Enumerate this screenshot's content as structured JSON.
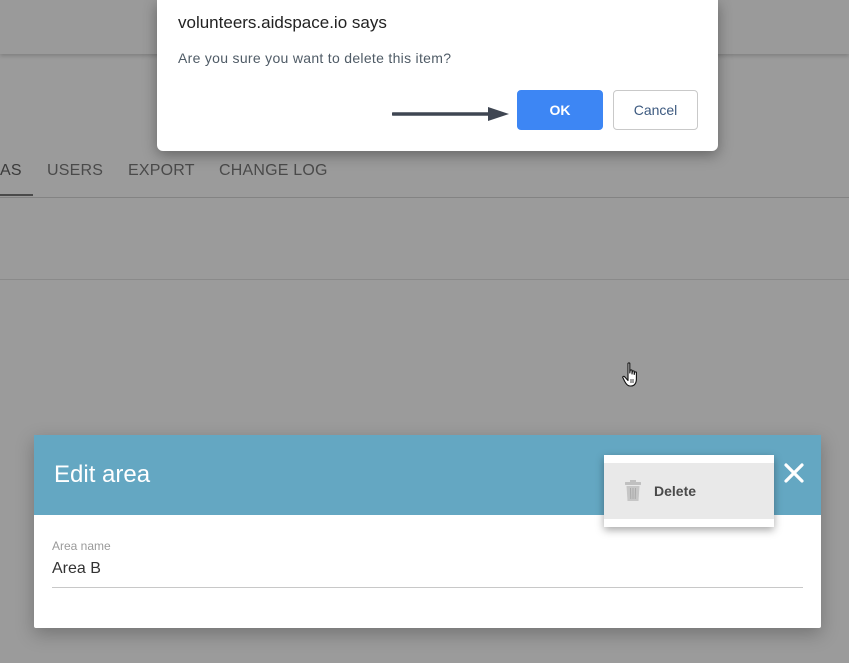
{
  "page": {
    "tabs": [
      {
        "label": "AS",
        "active": true
      },
      {
        "label": "USERS",
        "active": false
      },
      {
        "label": "EXPORT",
        "active": false
      },
      {
        "label": "CHANGE LOG",
        "active": false
      }
    ]
  },
  "edit_panel": {
    "title": "Edit area",
    "close_icon": "close-icon",
    "field_label": "Area name",
    "field_value": "Area B",
    "header_color": "#64a7c2"
  },
  "context_menu": {
    "items": [
      {
        "label": "Delete",
        "icon": "trash-icon"
      }
    ]
  },
  "confirm_dialog": {
    "title": "volunteers.aidspace.io says",
    "message": "Are you sure you want to delete this item?",
    "ok_label": "OK",
    "cancel_label": "Cancel",
    "ok_color": "#3d86f4"
  }
}
